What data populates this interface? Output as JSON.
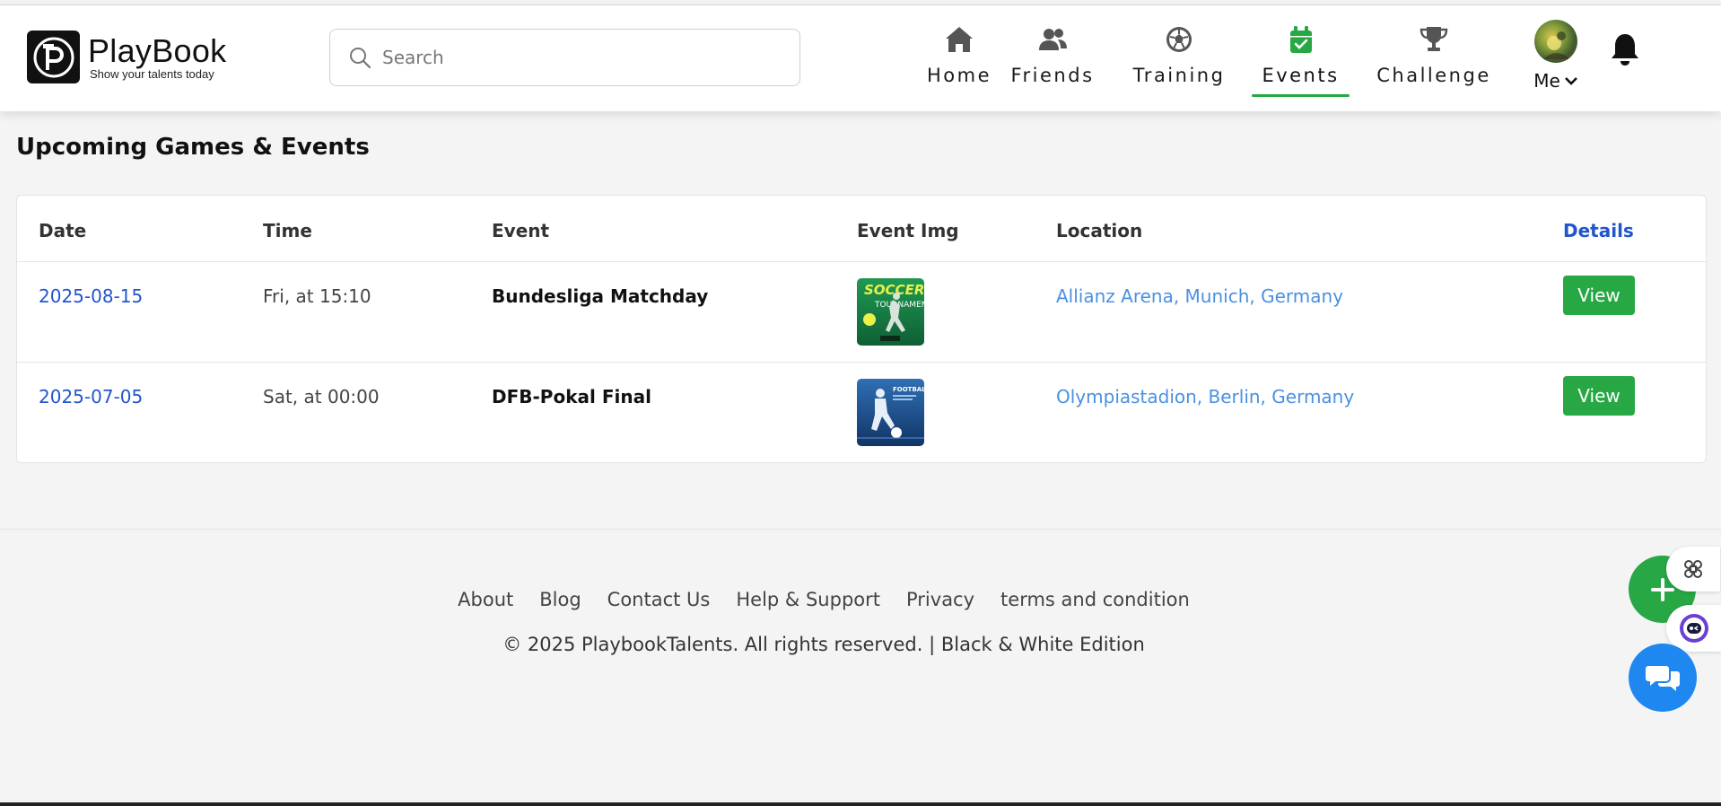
{
  "header": {
    "logo": {
      "name": "PlayBook",
      "tagline": "Show your talents today"
    },
    "search": {
      "placeholder": "Search",
      "value": ""
    },
    "nav": [
      {
        "id": "home",
        "label": "Home",
        "icon": "home-icon"
      },
      {
        "id": "friends",
        "label": "Friends",
        "icon": "friends-icon"
      },
      {
        "id": "training",
        "label": "Training",
        "icon": "soccer-ball-icon"
      },
      {
        "id": "events",
        "label": "Events",
        "icon": "calendar-check-icon",
        "active": true
      },
      {
        "id": "challenge",
        "label": "Challenge",
        "icon": "trophy-icon"
      }
    ],
    "me_label": "Me",
    "accent_color": "#27a844"
  },
  "main": {
    "title": "Upcoming Games & Events",
    "table": {
      "headers": {
        "date": "Date",
        "time": "Time",
        "event": "Event",
        "event_img": "Event Img",
        "location": "Location",
        "details": "Details"
      },
      "rows": [
        {
          "date": "2025-08-15",
          "time": "Fri, at 15:10",
          "event": "Bundesliga Matchday",
          "image": "soccer-tournament-poster",
          "location": "Allianz Arena, Munich, Germany",
          "action": "View"
        },
        {
          "date": "2025-07-05",
          "time": "Sat, at 00:00",
          "event": "DFB-Pokal Final",
          "image": "football-player-poster",
          "location": "Olympiastadion, Berlin, Germany",
          "action": "View"
        }
      ]
    }
  },
  "footer": {
    "links": [
      "About",
      "Blog",
      "Contact Us",
      "Help & Support",
      "Privacy",
      "terms and condition"
    ],
    "copyright": "© 2025 PlaybookTalents. All rights reserved. | Black & White Edition"
  },
  "floating": {
    "add_icon": "plus-icon",
    "grid_icon": "command-icon",
    "bot_icon": "bot-icon",
    "chat_icon": "chat-icon"
  }
}
